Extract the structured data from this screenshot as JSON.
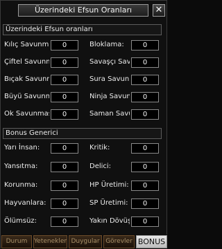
{
  "window": {
    "title": "Üzerindeki Efsun Oranları",
    "close_glyph": "✕"
  },
  "section1": {
    "header": "Üzerindeki Efsun oranları",
    "rows": [
      {
        "left_label": "Kılıç Savunması",
        "left_value": "0",
        "right_label": "Bloklama:",
        "right_value": "0"
      },
      {
        "left_label": "Çiftel Savunması",
        "left_value": "0",
        "right_label": "Savaşçı Savunması",
        "right_value": "0"
      },
      {
        "left_label": "Bıçak Savunması",
        "left_value": "0",
        "right_label": "Sura Savunması",
        "right_value": "0"
      },
      {
        "left_label": "Büyü Savunması",
        "left_value": "0",
        "right_label": "Ninja Savunması",
        "right_value": "0"
      },
      {
        "left_label": "Ok Savunması",
        "left_value": "0",
        "right_label": "Saman Savunması",
        "right_value": "0"
      }
    ]
  },
  "section2": {
    "header": "Bonus Generici",
    "rows": [
      {
        "left_label": "Yarı İnsan:",
        "left_value": "0",
        "right_label": "Kritik:",
        "right_value": "0"
      },
      {
        "left_label": "Yansıtma:",
        "left_value": "0",
        "right_label": "Delici:",
        "right_value": "0"
      },
      {
        "left_label": "Korunma:",
        "left_value": "0",
        "right_label": "HP Üretimi:",
        "right_value": "0"
      },
      {
        "left_label": "Hayvanlara:",
        "left_value": "0",
        "right_label": "SP Üretimi:",
        "right_value": "0"
      },
      {
        "left_label": "Ölümsüz:",
        "left_value": "0",
        "right_label": "Yakın Dövüş",
        "right_value": "0"
      }
    ]
  },
  "tabs": [
    "Durum",
    "Yetenekler",
    "Duygular",
    "Görevler",
    "BONUS"
  ],
  "active_tab": "BONUS",
  "colors": {
    "accent": "#8a6a3a",
    "background": "#101010"
  }
}
